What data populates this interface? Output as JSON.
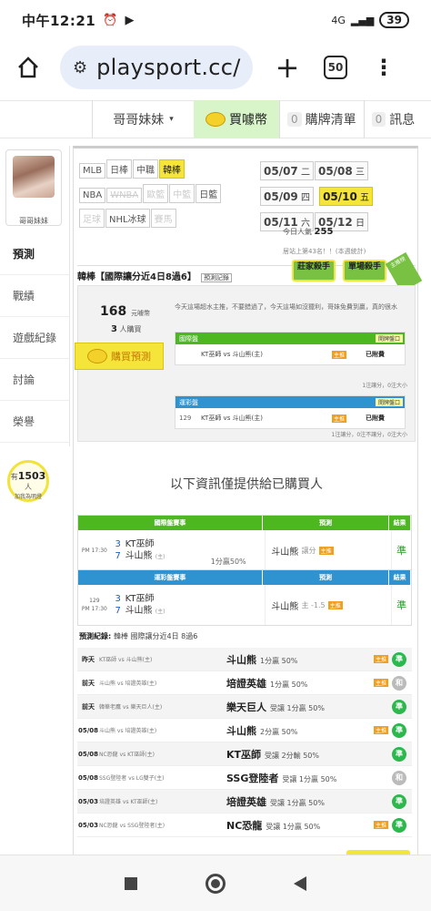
{
  "status": {
    "time": "中午12:21",
    "battery": "39",
    "net": "4G"
  },
  "browser": {
    "url": "playsport.cc/",
    "tab_count": "50"
  },
  "topnav": {
    "sister": "哥哥妹妹",
    "buy_coins": "買噱幣",
    "cart_count": "0",
    "cart": "購牌清單",
    "msg_count": "0",
    "msg": "訊息"
  },
  "sidebar": {
    "name": "哥哥妹妹",
    "items": [
      "預測",
      "戰績",
      "遊戲紀錄",
      "討論",
      "榮譽"
    ],
    "fans_prefix": "有",
    "fans_count": "1503",
    "fans_suffix": "人",
    "fans_note": "加我為明燈"
  },
  "leagues": {
    "row1": [
      "MLB",
      "日棒",
      "中職",
      "韓棒"
    ],
    "row2": [
      "NBA",
      "WNBA",
      "歐籃",
      "中籃",
      "日籃"
    ],
    "row3": [
      "足球",
      "NHL冰球",
      "賽馬"
    ]
  },
  "dates": [
    {
      "d": "05/07",
      "w": "二"
    },
    {
      "d": "05/08",
      "w": "三"
    },
    {
      "d": "05/09",
      "w": "四"
    },
    {
      "d": "05/10",
      "w": "五"
    },
    {
      "d": "05/11",
      "w": "六"
    },
    {
      "d": "05/12",
      "w": "日"
    }
  ],
  "popularity": {
    "label": "今日人氣",
    "value": "255",
    "rank": "居站上第43名！！(本週統計)"
  },
  "pick": {
    "title": "韓棒【國際讓分近4日8過6】",
    "record_link": "預測記錄",
    "badge1": "莊家殺手",
    "badge2": "單場殺手",
    "ribbon": "主推榜"
  },
  "purchase": {
    "price": "168",
    "price_unit": "元噱幣",
    "buyers": "3",
    "buyers_label": "人購買",
    "buy_button": "購買預測",
    "desc": "今天這場超水主推，不要錯過了，今天這場如沒獵利，哥妹免費到贏，真的很水",
    "intl_title": "國際盤",
    "open_label": "開牌盤口",
    "intl_row": {
      "teams": "KT巫師 vs 斗山熊(主)",
      "chip": "主推",
      "status": "已附費"
    },
    "intl_note": "1注讓分，0注大小",
    "tw_title": "運彩盤",
    "tw_row": {
      "no": "129",
      "teams": "KT巫師 vs 斗山熊(主)",
      "chip": "主推",
      "status": "已附費"
    },
    "tw_note": "1注讓分，0注不讓分，0注大小"
  },
  "info_line": "以下資訊僅提供給已購買人",
  "table1": {
    "h_game": "國際盤賽事",
    "h_pred": "預測",
    "h_res": "結果",
    "time": "PM 17:30",
    "s1": "3",
    "s2": "7",
    "t1": "KT巫師",
    "t2": "斗山熊",
    "home": "(主)",
    "result": "1分贏50%",
    "pick": "斗山熊",
    "pick_type": "讓分",
    "chip": "主推",
    "outcome": "準"
  },
  "table2": {
    "h_game": "運彩盤賽事",
    "h_pred": "預測",
    "h_res": "結果",
    "no": "129",
    "time": "PM 17:30",
    "s1": "3",
    "s2": "7",
    "t1": "KT巫師",
    "t2": "斗山熊",
    "home": "(主)",
    "pick": "斗山熊",
    "pick_type": "主 -1.5",
    "chip": "主推",
    "outcome": "準"
  },
  "history_title": "預測紀錄:",
  "history_sub": "韓棒 國際讓分近4日 8過6",
  "history": [
    {
      "date": "昨天",
      "game": "KT巫師 vs 斗山熊(主)",
      "pick": "斗山熊",
      "detail": "1分贏 50%",
      "chip": "主推",
      "res": "準",
      "win": true
    },
    {
      "date": "前天",
      "game": "斗山熊 vs 培證英雄(主)",
      "pick": "培證英雄",
      "detail": "1分贏 50%",
      "chip": "主推",
      "res": "和",
      "win": false
    },
    {
      "date": "前天",
      "game": "韓華老鷹 vs 樂天巨人(主)",
      "pick": "樂天巨人",
      "detail": "受讓 1分贏 50%",
      "chip": "",
      "res": "準",
      "win": true
    },
    {
      "date": "05/08",
      "game": "斗山熊 vs 培證英雄(主)",
      "pick": "斗山熊",
      "detail": "2分贏 50%",
      "chip": "主推",
      "res": "準",
      "win": true
    },
    {
      "date": "05/08",
      "game": "NC恐龍 vs KT巫師(主)",
      "pick": "KT巫師",
      "detail": "受讓 2分輸 50%",
      "chip": "",
      "res": "準",
      "win": true
    },
    {
      "date": "05/08",
      "game": "SSG登陸者 vs LG雙子(主)",
      "pick": "SSG登陸者",
      "detail": "受讓 1分贏 50%",
      "chip": "",
      "res": "和",
      "win": false
    },
    {
      "date": "05/03",
      "game": "培證英雄 vs KT巫師(主)",
      "pick": "培證英雄",
      "detail": "受讓 1分贏 50%",
      "chip": "",
      "res": "準",
      "win": true
    },
    {
      "date": "05/03",
      "game": "NC恐龍 vs SSG登陸者(主)",
      "pick": "NC恐龍",
      "detail": "受讓 1分贏 50%",
      "chip": "主推",
      "res": "準",
      "win": true
    }
  ],
  "colors": {
    "green_header": "#4cb71f",
    "blue_header": "#2f93d1",
    "yellow": "#f5e53a",
    "win": "#2db84d"
  }
}
